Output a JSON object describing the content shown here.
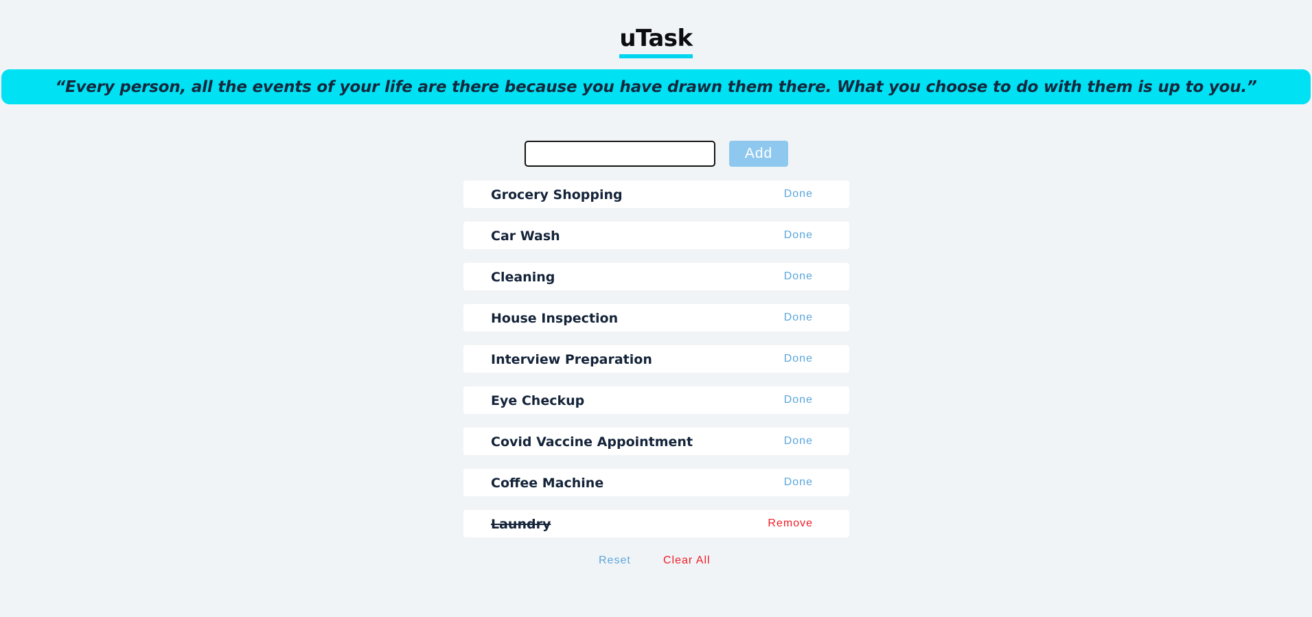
{
  "app": {
    "title": "uTask",
    "quote": "“Every person, all the events of your life are there because you have drawn them there. What you choose to do with them is up to you.”"
  },
  "form": {
    "input_value": "",
    "input_placeholder": "",
    "add_label": "Add"
  },
  "tasks": [
    {
      "name": "Grocery Shopping",
      "action": "Done",
      "completed": false
    },
    {
      "name": "Car Wash",
      "action": "Done",
      "completed": false
    },
    {
      "name": "Cleaning",
      "action": "Done",
      "completed": false
    },
    {
      "name": "House Inspection",
      "action": "Done",
      "completed": false
    },
    {
      "name": "Interview Preparation",
      "action": "Done",
      "completed": false
    },
    {
      "name": "Eye Checkup",
      "action": "Done",
      "completed": false
    },
    {
      "name": "Covid Vaccine Appointment",
      "action": "Done",
      "completed": false
    },
    {
      "name": "Coffee Machine",
      "action": "Done",
      "completed": false
    },
    {
      "name": "Laundry",
      "action": "Remove",
      "completed": true
    }
  ],
  "footer": {
    "reset_label": "Reset",
    "clear_all_label": "Clear All"
  },
  "colors": {
    "background": "#f1f4f7",
    "accent_cyan": "#00e1f4",
    "add_button": "#8ec8ee",
    "done_blue": "#5aa5db",
    "remove_red": "#ee1b24",
    "task_text": "#142339"
  }
}
